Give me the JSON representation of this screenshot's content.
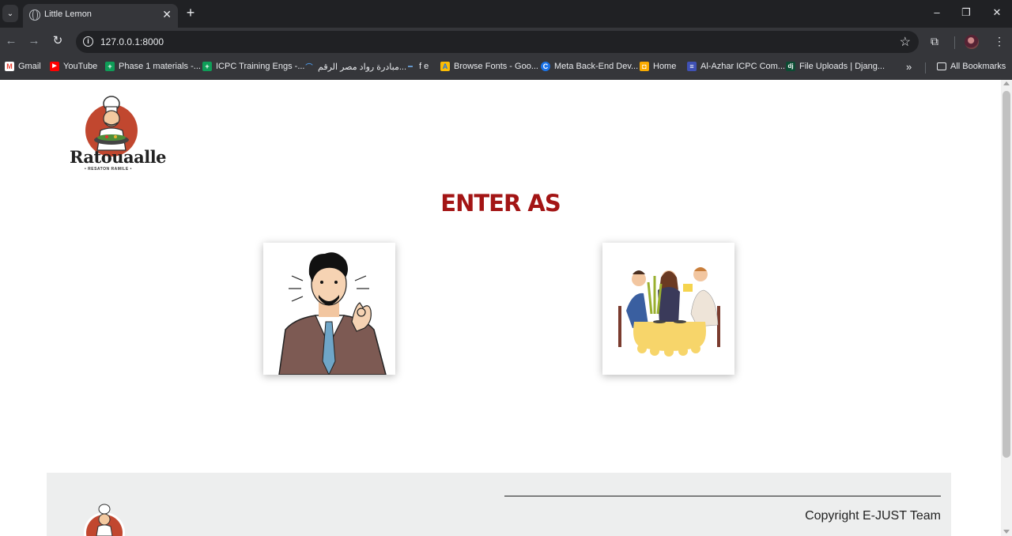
{
  "browser": {
    "tab_title": "Little Lemon",
    "url": "127.0.0.1:8000",
    "bookmarks": [
      {
        "label": "Gmail",
        "icon": "gmail-icon"
      },
      {
        "label": "YouTube",
        "icon": "youtube-icon"
      },
      {
        "label": "Phase 1 materials -...",
        "icon": "sheets-icon"
      },
      {
        "label": "ICPC Training Engs -...",
        "icon": "sheets-icon"
      },
      {
        "label": "مبادرة رواد مصر الرقم...",
        "icon": "initiative-icon"
      },
      {
        "label": "f e",
        "icon": "fe-icon"
      },
      {
        "label": "Browse Fonts - Goo...",
        "icon": "google-fonts-icon"
      },
      {
        "label": "Meta Back-End Dev...",
        "icon": "coursera-icon"
      },
      {
        "label": "Home",
        "icon": "classroom-icon"
      },
      {
        "label": "Al-Azhar ICPC Com...",
        "icon": "forms-icon"
      },
      {
        "label": "File Uploads | Djang...",
        "icon": "django-icon"
      }
    ],
    "all_bookmarks": "All Bookmarks"
  },
  "page": {
    "logo_text": "Ratouaalle",
    "logo_subtext": "• RESATON RAMILE •",
    "heading": "ENTER AS",
    "choices": [
      {
        "name": "staff",
        "icon": "staff-person-icon"
      },
      {
        "name": "customer",
        "icon": "diners-icon"
      }
    ],
    "footer": {
      "copyright": "Copyright E-JUST Team"
    }
  },
  "colors": {
    "heading": "#a31515",
    "footer_bg": "#edeeee",
    "browser_dark": "#202124",
    "browser_toolbar": "#35363a"
  }
}
